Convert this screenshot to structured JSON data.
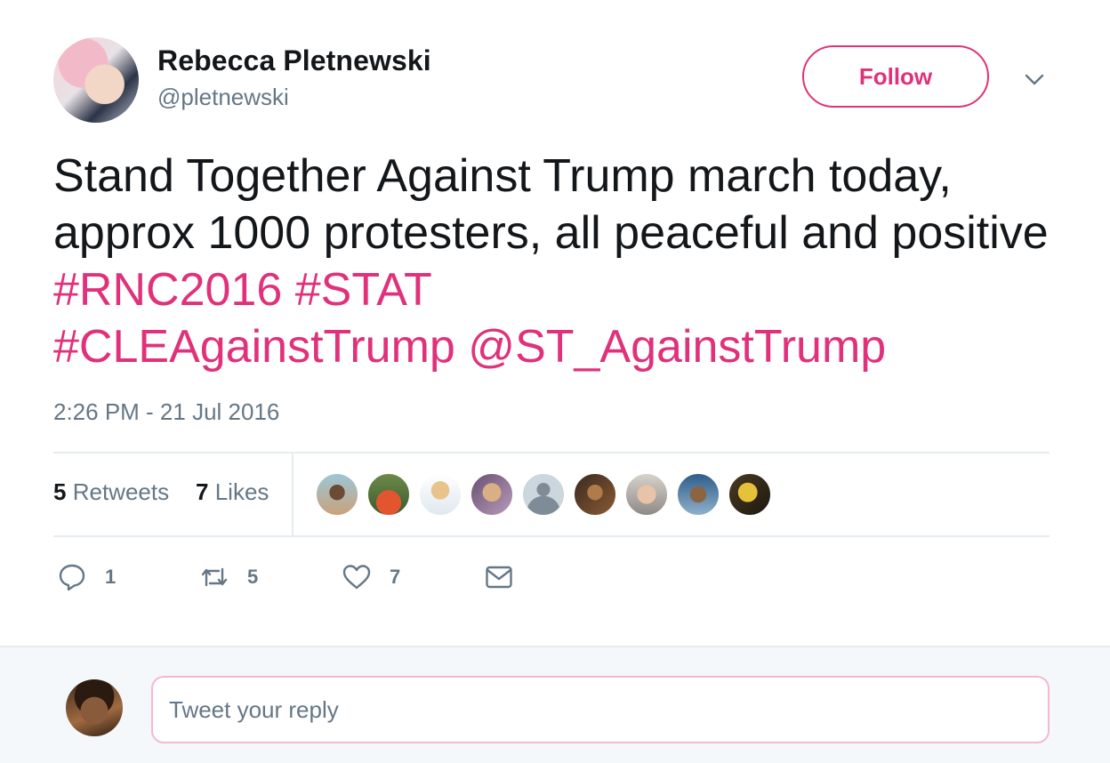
{
  "author": {
    "display_name": "Rebecca Pletnewski",
    "handle": "@pletnewski"
  },
  "follow_label": "Follow",
  "accent_color": "#e0317a",
  "tweet": {
    "text_plain": "Stand Together Against Trump march today, approx 1000 protesters, all peaceful and positive",
    "hashtag_1": "#RNC2016",
    "hashtag_2": "#STAT",
    "hashtag_3": "#CLEAgainstTrump",
    "mention_1": "@ST_AgainstTrump",
    "timestamp": "2:26 PM - 21 Jul 2016"
  },
  "stats": {
    "retweets_count": "5",
    "retweets_label": "Retweets",
    "likes_count": "7",
    "likes_label": "Likes"
  },
  "actions": {
    "reply_count": "1",
    "retweet_count": "5",
    "like_count": "7"
  },
  "reply": {
    "placeholder": "Tweet your reply"
  }
}
